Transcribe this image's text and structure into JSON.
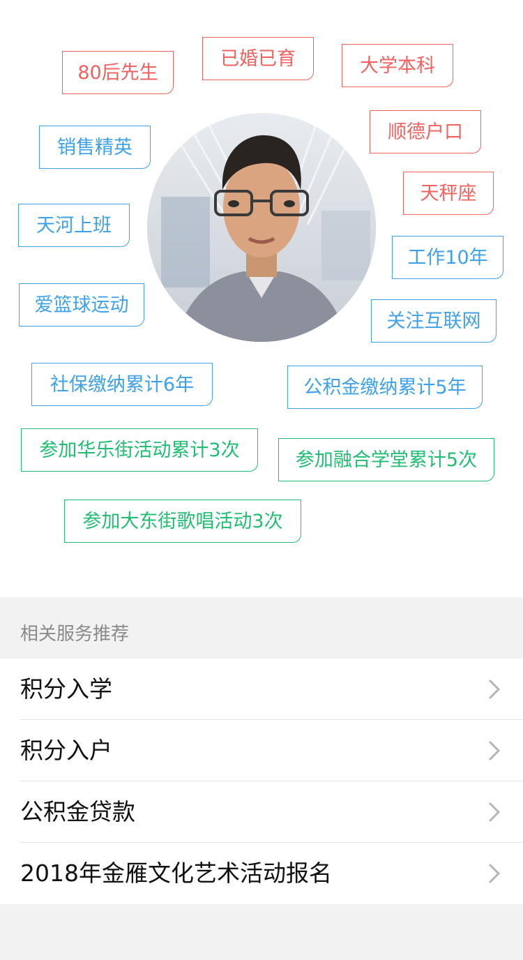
{
  "profile": {
    "tags": [
      {
        "label": "80后先生",
        "color": "red"
      },
      {
        "label": "已婚已育",
        "color": "red"
      },
      {
        "label": "大学本科",
        "color": "red"
      },
      {
        "label": "销售精英",
        "color": "blue"
      },
      {
        "label": "顺德户口",
        "color": "red"
      },
      {
        "label": "天秤座",
        "color": "red"
      },
      {
        "label": "天河上班",
        "color": "blue"
      },
      {
        "label": "工作10年",
        "color": "blue"
      },
      {
        "label": "爱篮球运动",
        "color": "blue"
      },
      {
        "label": "关注互联网",
        "color": "blue"
      },
      {
        "label": "社保缴纳累计6年",
        "color": "blue"
      },
      {
        "label": "公积金缴纳累计5年",
        "color": "blue"
      },
      {
        "label": "参加华乐街活动累计3次",
        "color": "green"
      },
      {
        "label": "参加融合学堂累计5次",
        "color": "green"
      },
      {
        "label": "参加大东街歌唱活动3次",
        "color": "green"
      }
    ]
  },
  "services": {
    "header": "相关服务推荐",
    "items": [
      {
        "label": "积分入学"
      },
      {
        "label": "积分入户"
      },
      {
        "label": "公积金贷款"
      },
      {
        "label": "2018年金雁文化艺术活动报名"
      }
    ]
  },
  "colors": {
    "red": "#f0625f",
    "blue": "#3fa2e8",
    "green": "#21bd73",
    "chevron": "#b5b5b5"
  },
  "icons": {
    "avatar": "user-photo",
    "chevron": "chevron-right-icon"
  }
}
